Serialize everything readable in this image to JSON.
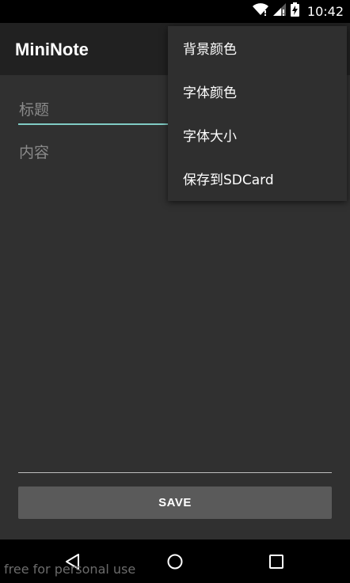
{
  "status_bar": {
    "time": "10:42",
    "icons": [
      "wifi-icon",
      "signal-icon",
      "battery-charging-icon"
    ]
  },
  "app_bar": {
    "title": "MiniNote"
  },
  "editor": {
    "title_placeholder": "标题",
    "content_placeholder": "内容",
    "accent_color": "#80cbc4"
  },
  "save_button": {
    "label": "SAVE"
  },
  "overflow_menu": {
    "items": [
      "背景颜色",
      "字体颜色",
      "字体大小",
      "保存到SDCard"
    ]
  },
  "nav_bar": {
    "icons": [
      "back-icon",
      "home-icon",
      "recents-icon"
    ]
  },
  "watermark": "free for personal use"
}
